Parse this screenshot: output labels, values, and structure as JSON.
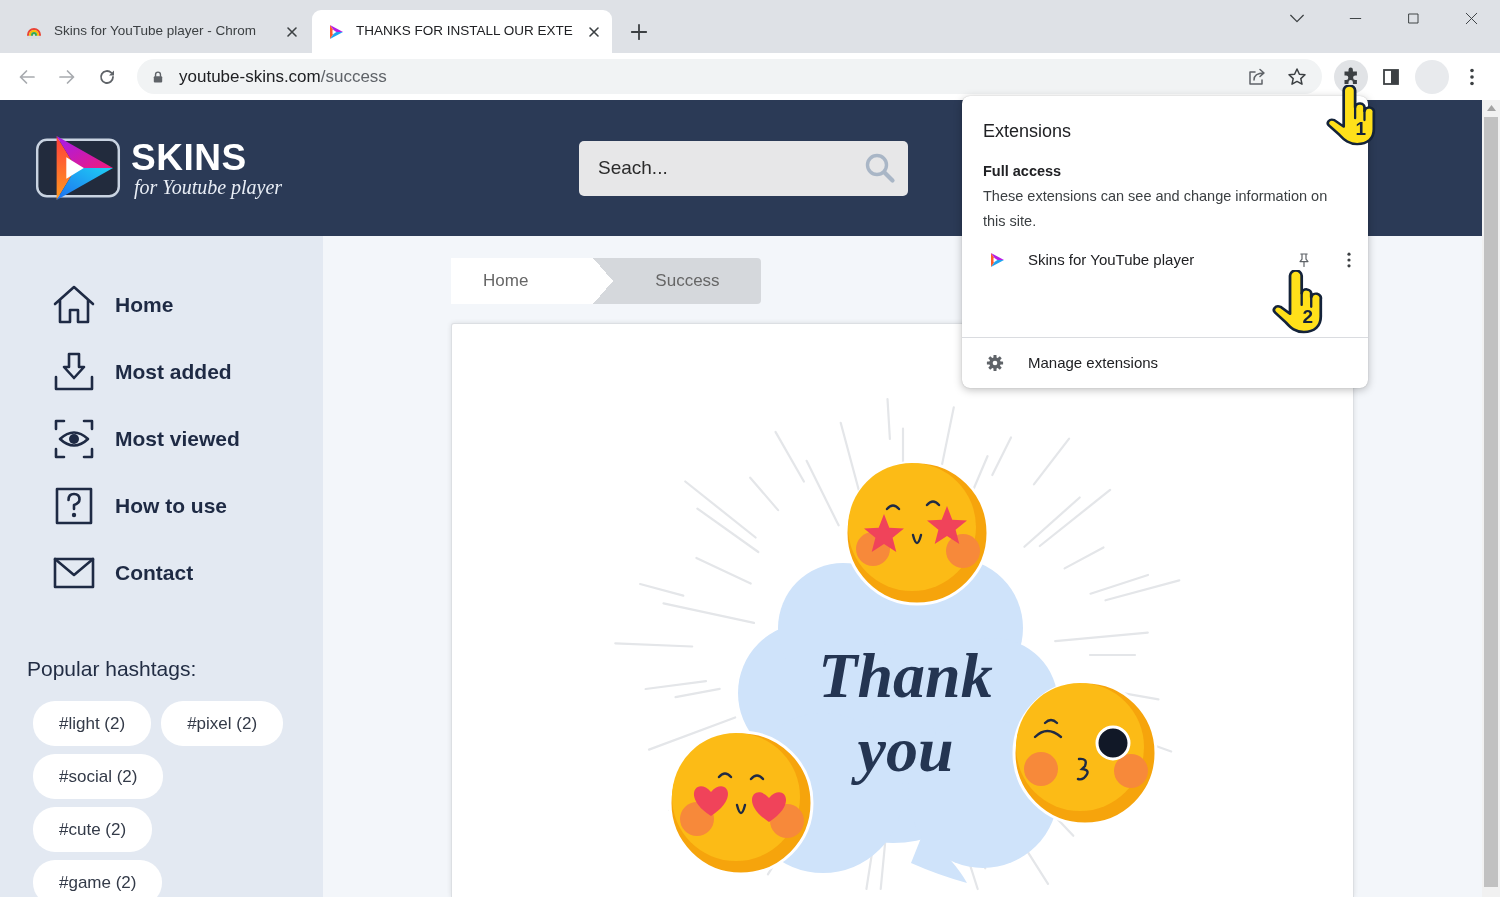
{
  "browser": {
    "tabs": [
      {
        "title": "Skins for YouTube player - Chrom",
        "kind": "rainbow",
        "selected": false
      },
      {
        "title": "THANKS FOR INSTALL OUR EXTE",
        "kind": "play",
        "selected": true
      }
    ],
    "toolbar": {
      "back_disabled": true,
      "forward_disabled": true,
      "extensions_active": true
    },
    "address": {
      "host": "youtube-skins.com",
      "path": "/success"
    }
  },
  "site": {
    "logo": {
      "title": "SKINS",
      "subtitle": "for Youtube player"
    },
    "search": {
      "placeholder": "Seach..."
    },
    "nav": [
      {
        "label": "Home",
        "kind": "home"
      },
      {
        "label": "Most added",
        "kind": "download"
      },
      {
        "label": "Most viewed",
        "kind": "eye"
      },
      {
        "label": "How to use",
        "kind": "help"
      },
      {
        "label": "Contact",
        "kind": "mail"
      }
    ],
    "hashtags_title": "Popular hashtags:",
    "hashtags": [
      "#light (2)",
      "#pixel (2)",
      "#social (2)",
      "#cute (2)",
      "#game (2)"
    ],
    "breadcrumb": [
      {
        "label": "Home",
        "current": false
      },
      {
        "label": "Success",
        "current": true
      }
    ],
    "illustration": {
      "lettering": "Thank you"
    }
  },
  "extensions_popup": {
    "title": "Extensions",
    "section_title": "Full access",
    "description": "These extensions can see and change information on this site.",
    "items": [
      {
        "name": "Skins for YouTube player",
        "pinned": false
      }
    ],
    "manage_label": "Manage extensions"
  },
  "callouts": [
    {
      "number": "1"
    },
    {
      "number": "2"
    }
  ]
}
